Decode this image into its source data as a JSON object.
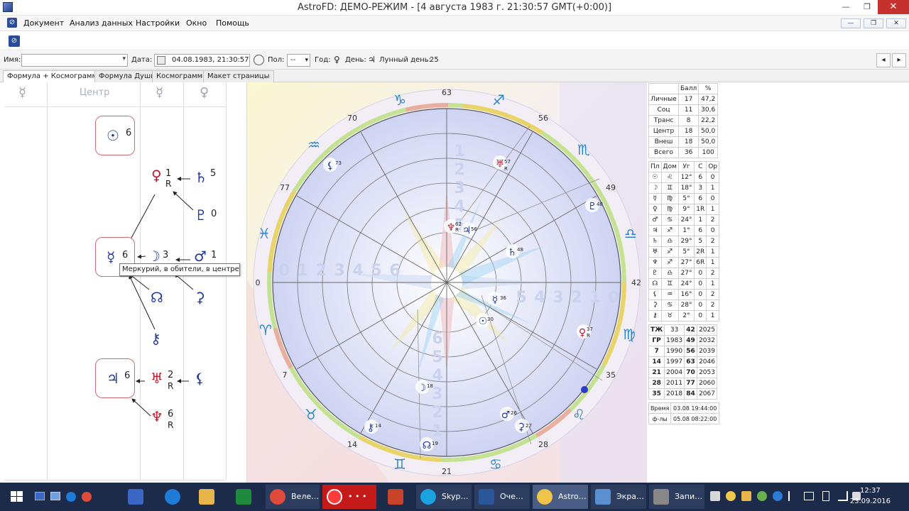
{
  "window": {
    "title": "AstroFD: ДЕМО-РЕЖИМ - [4 августа 1983 г. 21:30:57 GMT(+0:00)]",
    "minimize": "—",
    "maximize": "❐",
    "close": "✕"
  },
  "menu": [
    "Документ",
    "Анализ данных",
    "Настройки",
    "Окно",
    "Помощь"
  ],
  "mdi": {
    "min": "—",
    "restore": "❐",
    "close": "✕"
  },
  "toolbar": {
    "name_label": "Имя:",
    "name_value": "",
    "date_label": "Дата:",
    "date_value": "04.08.1983, 21:30:57",
    "sex_label": "Пол:",
    "sex_value": "--",
    "year_label": "Год:",
    "year_symbol": "♀",
    "day_label": "День:",
    "day_symbol": "♃",
    "lunar_label": "Лунный день:",
    "lunar_value": "25",
    "nav_prev": "◂",
    "nav_next": "▸"
  },
  "tabs": [
    "Формула + Космограмма",
    "Формула Души",
    "Космограмма",
    "Макет страницы"
  ],
  "formula": {
    "head_left": "☿",
    "center_label": "Центр",
    "head_mid": "☿",
    "head_right": "♀",
    "sun": {
      "symbol": "☉",
      "num": "6"
    },
    "venus": {
      "symbol": "♀",
      "num": "1",
      "r": "R"
    },
    "saturn": {
      "symbol": "♄",
      "num": "5"
    },
    "pluto": {
      "symbol": "♇",
      "num": "0"
    },
    "mercury": {
      "symbol": "☿",
      "num": "6"
    },
    "moon": {
      "symbol": "☽",
      "num": "3"
    },
    "mars": {
      "symbol": "♂",
      "num": "1"
    },
    "node": {
      "symbol": "☊"
    },
    "ceres": {
      "symbol": "⚳"
    },
    "chiron": {
      "symbol": "⚷"
    },
    "jupiter": {
      "symbol": "♃",
      "num": "6"
    },
    "uranus": {
      "symbol": "♅",
      "num": "2",
      "r": "R"
    },
    "lilith": {
      "symbol": "⚸"
    },
    "neptune": {
      "symbol": "♆",
      "num": "6",
      "r": "R"
    },
    "tooltip": "Меркурий, в обители, в центре"
  },
  "wheel": {
    "degrees": [
      "63",
      "56",
      "49",
      "42",
      "35",
      "28",
      "21",
      "14",
      "7",
      "0",
      "77",
      "70"
    ],
    "signs": [
      "♑",
      "♐",
      "♏",
      "♎",
      "♍",
      "♌",
      "♋",
      "♊",
      "♉",
      "♈",
      "♓",
      "♒"
    ],
    "left_digits": [
      "0",
      "1",
      "2",
      "3",
      "4",
      "5",
      "6"
    ],
    "right_digits": [
      "5",
      "4",
      "3",
      "2",
      "1",
      "0"
    ],
    "top_digits": [
      "1",
      "2",
      "3",
      "4",
      "5"
    ],
    "bottom_digits": [
      "6",
      "5",
      "4",
      "3",
      "2",
      "1"
    ],
    "planets": [
      {
        "sym": "⚸",
        "num": "73",
        "r": ""
      },
      {
        "sym": "♅",
        "num": "57",
        "r": "R"
      },
      {
        "sym": "♇",
        "num": "48",
        "r": ""
      },
      {
        "sym": "♆",
        "num": "62",
        "r": "R"
      },
      {
        "sym": "♃",
        "num": "56",
        "r": ""
      },
      {
        "sym": "♄",
        "num": "48",
        "r": ""
      },
      {
        "sym": "☿",
        "num": "36",
        "r": ""
      },
      {
        "sym": "☉",
        "num": "30",
        "r": ""
      },
      {
        "sym": "♀",
        "num": "37",
        "r": "R"
      },
      {
        "sym": "☽",
        "num": "18",
        "r": ""
      },
      {
        "sym": "♂",
        "num": "26",
        "r": ""
      },
      {
        "sym": "⚳",
        "num": "27",
        "r": ""
      },
      {
        "sym": "⚷",
        "num": "14",
        "r": ""
      },
      {
        "sym": "☊",
        "num": "19",
        "r": ""
      }
    ]
  },
  "stats": {
    "score_head": [
      "",
      "Балл",
      "%"
    ],
    "score_rows": [
      [
        "Личные",
        "17",
        "47,2"
      ],
      [
        "Соц",
        "11",
        "30,6"
      ],
      [
        "Транс",
        "8",
        "22,2"
      ],
      [
        "Центр",
        "18",
        "50,0"
      ],
      [
        "Внеш",
        "18",
        "50,0"
      ],
      [
        "Всего",
        "36",
        "100"
      ]
    ],
    "planet_head": [
      "Пл",
      "Дом",
      "Уг",
      "С",
      "Ор"
    ],
    "planet_rows": [
      [
        "☉",
        "♌",
        "12°",
        "6",
        "0"
      ],
      [
        "☽",
        "♊",
        "18°",
        "3",
        "1"
      ],
      [
        "☿",
        "♍",
        "5°",
        "6",
        "0"
      ],
      [
        "♀",
        "♍",
        "9°",
        "1R",
        "1"
      ],
      [
        "♂",
        "♋",
        "24°",
        "1",
        "2"
      ],
      [
        "♃",
        "♐",
        "1°",
        "6",
        "0"
      ],
      [
        "♄",
        "♎",
        "29°",
        "5",
        "2"
      ],
      [
        "♅",
        "♐",
        "5°",
        "2R",
        "1"
      ],
      [
        "♆",
        "♐",
        "27°",
        "6R",
        "1"
      ],
      [
        "♇",
        "♎",
        "27°",
        "0",
        "2"
      ],
      [
        "☊",
        "♊",
        "24°",
        "0",
        "1"
      ],
      [
        "⚸",
        "♒",
        "16°",
        "0",
        "2"
      ],
      [
        "⚳",
        "♋",
        "28°",
        "0",
        "2"
      ],
      [
        "⚷",
        "♉",
        "2°",
        "0",
        "1"
      ]
    ],
    "cycle_rows": [
      [
        "ТЖ",
        "33",
        "42",
        "2025"
      ],
      [
        "ГР",
        "1983",
        "49",
        "2032"
      ],
      [
        "7",
        "1990",
        "56",
        "2039"
      ],
      [
        "14",
        "1997",
        "63",
        "2046"
      ],
      [
        "21",
        "2004",
        "70",
        "2053"
      ],
      [
        "28",
        "2011",
        "77",
        "2060"
      ],
      [
        "35",
        "2018",
        "84",
        "2067"
      ]
    ],
    "time_rows": [
      [
        "Время",
        "03.08 19:44:00"
      ],
      [
        "ф-лы",
        "05.08 08:22:00"
      ]
    ]
  },
  "taskbar": {
    "apps": [
      {
        "label": "",
        "color": "#3a66c4"
      },
      {
        "label": "",
        "color": "#1e7bd8"
      },
      {
        "label": "",
        "color": "#e8b54a"
      },
      {
        "label": "",
        "color": "#1f8a3b"
      },
      {
        "label": "Веле…",
        "color": "#e04a3a"
      },
      {
        "label": "• • •",
        "color": "#d21b1b"
      },
      {
        "label": "",
        "color": "#c9432a"
      },
      {
        "label": "Skyp…",
        "color": "#1aa3e0"
      },
      {
        "label": "Оче…",
        "color": "#2b579a"
      },
      {
        "label": "Astro…",
        "color": "#f0c34a"
      },
      {
        "label": "Экра…",
        "color": "#5a8fd0"
      },
      {
        "label": "Запи…",
        "color": "#888888"
      }
    ],
    "time": "12:37",
    "date": "23.09.2016"
  }
}
